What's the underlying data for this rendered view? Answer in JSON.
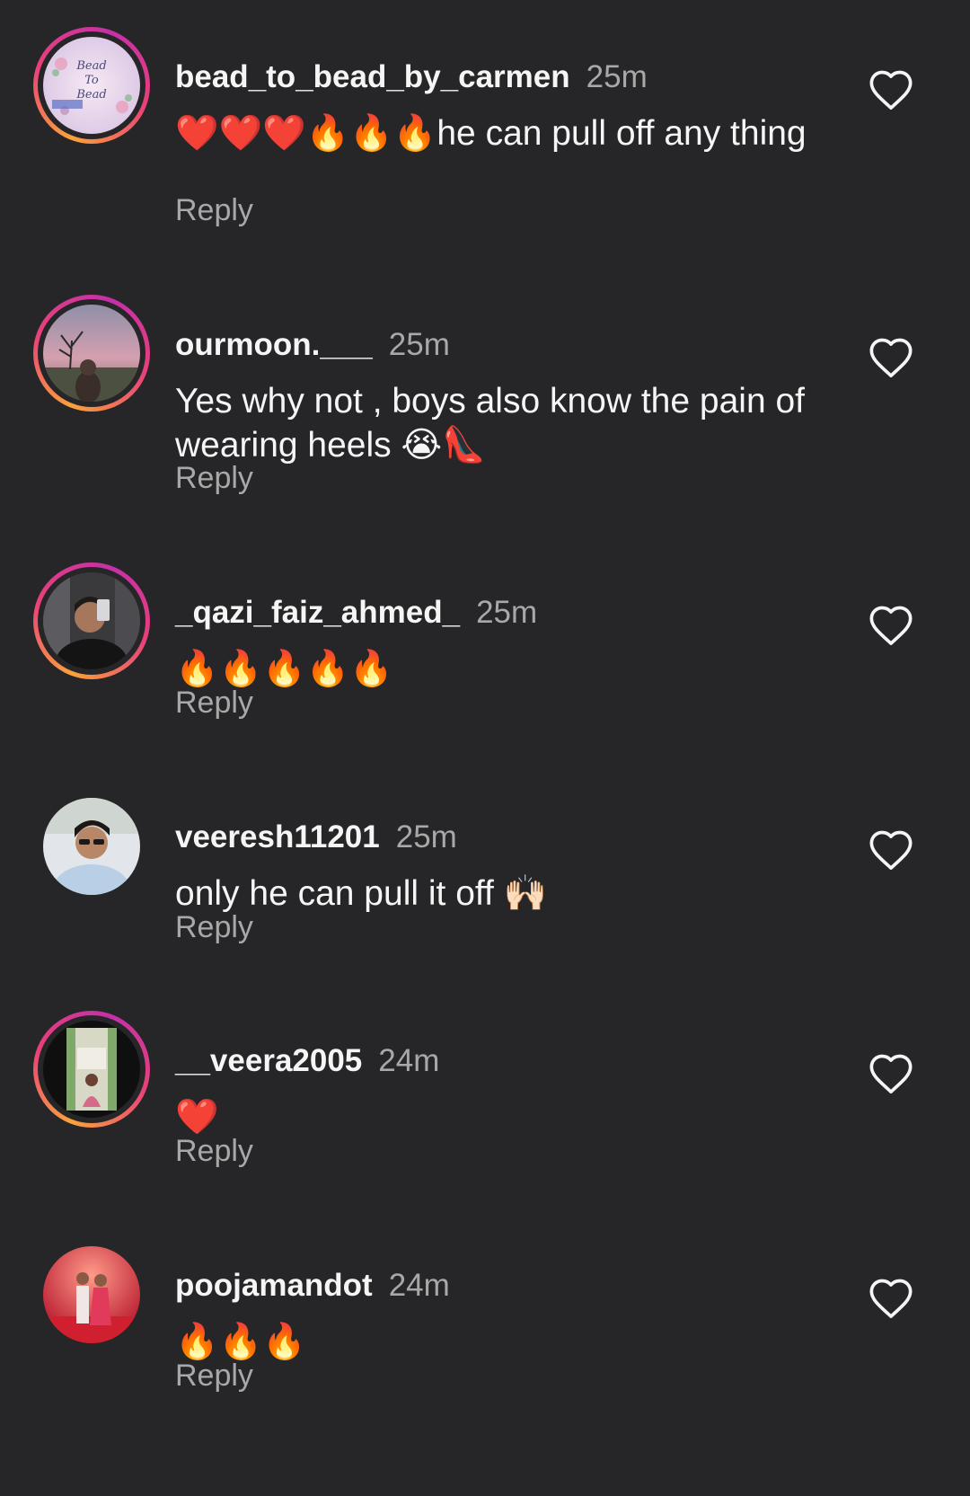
{
  "theme": {
    "background": "#262628",
    "text_primary": "#f5f5f5",
    "text_secondary": "#a8a8a8",
    "story_ring_start": "#f9a23b",
    "story_ring_end": "#c430a8"
  },
  "comments": [
    {
      "username": "bead_to_bead_by_carmen",
      "time": "25m",
      "text": "❤️❤️❤️🔥🔥🔥he can pull off any thing",
      "reply_label": "Reply",
      "avatar_story_ring": true,
      "avatar_icon": "bead-to-bead-logo-avatar",
      "avatar_logo_text": [
        "Bead",
        "To",
        "Bead"
      ],
      "like_icon": "heart-outline-icon"
    },
    {
      "username": "ourmoon.___",
      "time": "25m",
      "text": "Yes why not ,  boys also know the pain of wearing heels 😭👠",
      "reply_label": "Reply",
      "avatar_story_ring": true,
      "avatar_icon": "tree-at-dusk-photo-avatar",
      "like_icon": "heart-outline-icon"
    },
    {
      "username": "_qazi_faiz_ahmed_",
      "time": "25m",
      "text": "🔥🔥🔥🔥🔥",
      "reply_label": "Reply",
      "avatar_story_ring": true,
      "avatar_icon": "mirror-selfie-photo-avatar",
      "like_icon": "heart-outline-icon"
    },
    {
      "username": "veeresh11201",
      "time": "25m",
      "text": "only he can pull it off 🙌🏻",
      "reply_label": "Reply",
      "avatar_story_ring": false,
      "avatar_icon": "man-in-sunglasses-photo-avatar",
      "like_icon": "heart-outline-icon"
    },
    {
      "username": "__veera2005",
      "time": "24m",
      "text": "❤️",
      "reply_label": "Reply",
      "avatar_story_ring": true,
      "avatar_icon": "doorway-portrait-photo-avatar",
      "like_icon": "heart-outline-icon"
    },
    {
      "username": "poojamandot",
      "time": "24m",
      "text": "🔥🔥🔥",
      "reply_label": "Reply",
      "avatar_story_ring": false,
      "avatar_icon": "couple-wedding-photo-avatar",
      "like_icon": "heart-outline-icon"
    }
  ]
}
